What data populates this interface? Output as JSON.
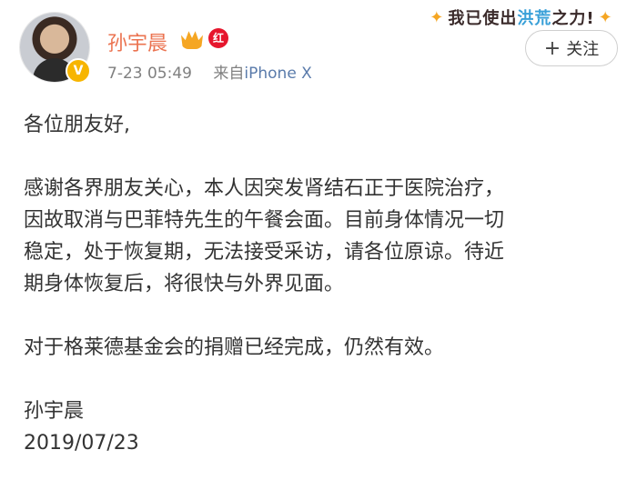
{
  "header": {
    "username": "孙宇晨",
    "red_badge_text": "红",
    "verified_badge": "V",
    "time": "7-23 05:49",
    "source_prefix": "来自",
    "source_device": "iPhone X",
    "follow_plus": "+",
    "follow_label": "关注",
    "sticker_text_a": "我已使出",
    "sticker_text_hl": "洪荒",
    "sticker_text_b": "之力!"
  },
  "icons": {
    "crown": "crown-icon",
    "verified": "verified-badge-icon",
    "plus": "plus-icon"
  },
  "post": {
    "greeting": "各位朋友好,",
    "para1_lines": [
      "感谢各界朋友关心，本人因突发肾结石正于医院治疗，",
      "因故取消与巴菲特先生的午餐会面。目前身体情况一切",
      "稳定，处于恢复期，无法接受采访，请各位原谅。待近",
      "期身体恢复后，将很快与外界见面。"
    ],
    "para2": "对于格莱德基金会的捐赠已经完成，仍然有效。",
    "signature": "孙宇晨",
    "date": "2019/07/23"
  },
  "colors": {
    "username": "#eb7350",
    "meta": "#808080",
    "device_link": "#5a7bab"
  }
}
